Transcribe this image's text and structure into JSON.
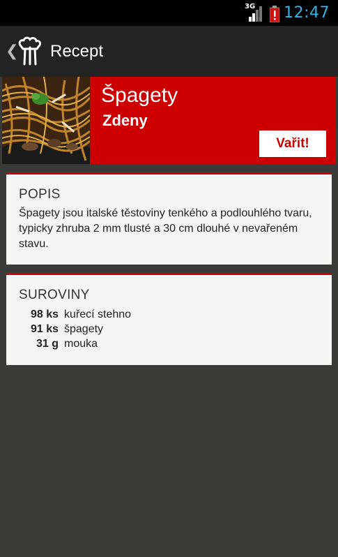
{
  "status": {
    "time": "12:47",
    "network": "3G",
    "icons": [
      "signal-icon",
      "battery-alert-icon"
    ]
  },
  "actionbar": {
    "back_icon": "chevron-left-icon",
    "app_icon": "chef-hat-icon",
    "title": "Recept"
  },
  "recipe": {
    "name": "Špagety",
    "author": "Zdeny",
    "cook_label": "Vařit!"
  },
  "description": {
    "title": "POPIS",
    "text": "Špagety jsou italské těstoviny tenkého a podlouhlého tvaru, typicky zhruba 2 mm tlusté a 30 cm dlouhé v nevařeném stavu."
  },
  "ingredients": {
    "title": "SUROVINY",
    "items": [
      {
        "qty": "98 ks",
        "name": "kuřecí stehno"
      },
      {
        "qty": "91 ks",
        "name": "špagety"
      },
      {
        "qty": "31 g",
        "name": "mouka"
      }
    ]
  },
  "colors": {
    "accent": "#cc0000",
    "clock": "#33b5e5",
    "background": "#3a3b39",
    "actionbar": "#222322"
  }
}
